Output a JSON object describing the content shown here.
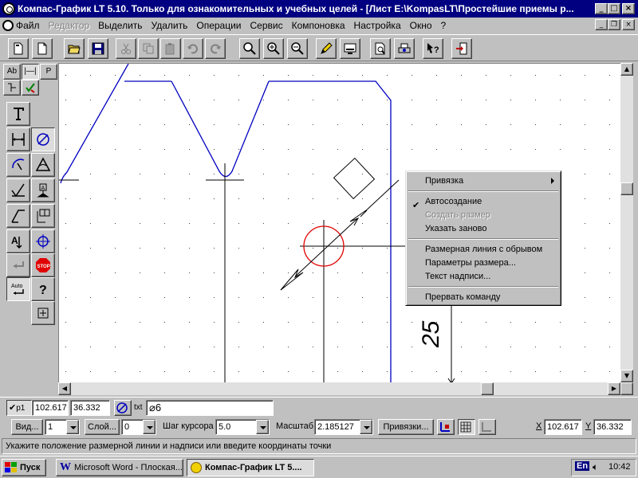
{
  "window": {
    "title": "Компас-График LT 5.10. Только для ознакомительных и учебных целей - [Лист E:\\KompasLT\\Простейшие приемы р..."
  },
  "menu": {
    "items": [
      {
        "label": "Файл",
        "disabled": false
      },
      {
        "label": "Редактор",
        "disabled": true
      },
      {
        "label": "Выделить",
        "disabled": false
      },
      {
        "label": "Удалить",
        "disabled": false
      },
      {
        "label": "Операции",
        "disabled": false
      },
      {
        "label": "Сервис",
        "disabled": false
      },
      {
        "label": "Компоновка",
        "disabled": false
      },
      {
        "label": "Настройка",
        "disabled": false
      },
      {
        "label": "Окно",
        "disabled": false
      },
      {
        "label": "?",
        "disabled": false
      }
    ]
  },
  "left_panel": {
    "tabs": [
      "Ab",
      "|—|",
      "P"
    ]
  },
  "context_menu": {
    "items": [
      {
        "label": "Привязка",
        "disabled": false,
        "submenu": true
      },
      {
        "label": "Автосоздание",
        "disabled": false,
        "checked": true
      },
      {
        "label": "Создать размер",
        "disabled": true
      },
      {
        "label": "Указать заново",
        "disabled": false
      },
      {
        "label": "Размерная линия с обрывом",
        "disabled": false
      },
      {
        "label": "Параметры размера...",
        "disabled": false
      },
      {
        "label": "Текст надписи...",
        "disabled": false
      },
      {
        "label": "Прервать команду",
        "disabled": false
      }
    ]
  },
  "drawing": {
    "dimension_text": "25",
    "colors": {
      "contour": "#0000c0",
      "circle": "#e00000",
      "grid": "#404040"
    }
  },
  "coord_bar": {
    "p1_label": "p1",
    "x_value": "102.617",
    "y_value": "36.332",
    "txt_label": "txt",
    "txt_value": "⌀6"
  },
  "settings_bar": {
    "view_button": "Вид...",
    "view_value": "1",
    "layer_button": "Слой...",
    "layer_value": "0",
    "cursor_step_label": "Шаг курсора",
    "cursor_step_value": "5.0",
    "scale_label": "Масштаб",
    "scale_value": "2.185127",
    "snaps_button": "Привязки...",
    "x_label": "X",
    "x_value": "102.617",
    "y_label": "Y",
    "y_value": "36.332"
  },
  "status": {
    "text": "Укажите положение размерной линии и надписи или введите координаты точки"
  },
  "taskbar": {
    "start_label": "Пуск",
    "tasks": [
      {
        "label": "Microsoft Word - Плоская...",
        "active": false
      },
      {
        "label": "Компас-График LT 5....",
        "active": true
      }
    ],
    "lang": "En",
    "clock": "10:42"
  }
}
